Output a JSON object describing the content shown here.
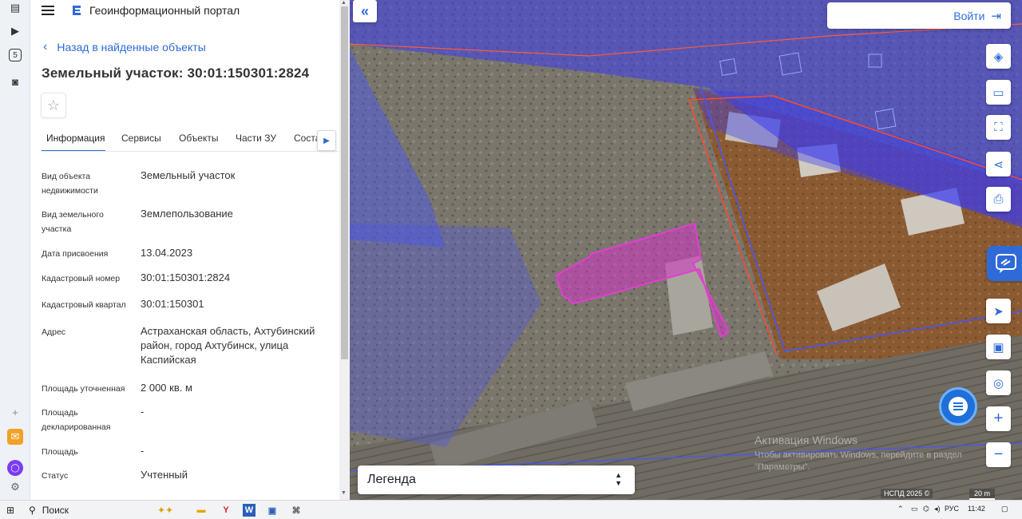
{
  "portal": {
    "title": "Геоинформационный портал"
  },
  "panel": {
    "back_label": "Назад в найденные объекты",
    "object_title": "Земельный участок: 30:01:150301:2824",
    "tabs": [
      {
        "label": "Информация"
      },
      {
        "label": "Сервисы"
      },
      {
        "label": "Объекты"
      },
      {
        "label": "Части ЗУ"
      },
      {
        "label": "Соста"
      }
    ],
    "fields": [
      {
        "label": "Вид объекта недвижимости",
        "value": "Земельный участок"
      },
      {
        "label": "Вид земельного участка",
        "value": "Землепользование"
      },
      {
        "label": "Дата присвоения",
        "value": "13.04.2023"
      },
      {
        "label": "Кадастровый номер",
        "value": "30:01:150301:2824"
      },
      {
        "label": "Кадастровый квартал",
        "value": "30:01:150301"
      },
      {
        "label": "Адрес",
        "value": "Астраханская область, Ахтубинский район, город Ахтубинск, улица Каспийская"
      },
      {
        "label": "Площадь уточненная",
        "value": "2 000 кв. м"
      },
      {
        "label": "Площадь декларированная",
        "value": "-"
      },
      {
        "label": "Площадь",
        "value": "-"
      },
      {
        "label": "Статус",
        "value": "Учтенный"
      }
    ]
  },
  "map": {
    "login_label": "Войти",
    "legend_label": "Легенда",
    "copyright": "НСПД 2025 ©",
    "scale": "20 m",
    "watermark_title": "Активация Windows",
    "watermark_text": "Чтобы активировать Windows, перейдите в раздел \"Параметры\"."
  },
  "taskbar": {
    "search_label": "Поиск",
    "lang": "РУС",
    "time": "11:42"
  },
  "colors": {
    "accent": "#2f6bd8",
    "parcel_highlight": "#d633c6",
    "zone_fill": "#3b3df0"
  }
}
